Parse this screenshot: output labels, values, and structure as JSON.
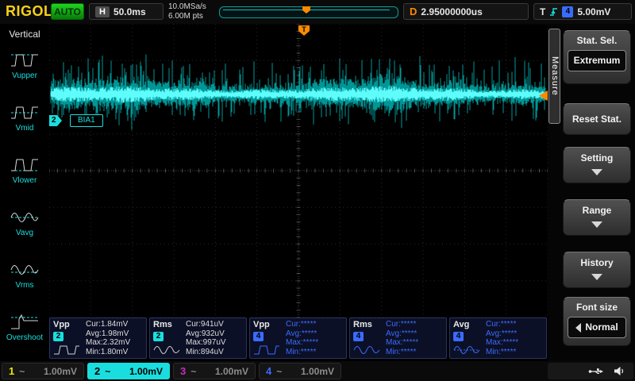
{
  "brand": "RIGOL",
  "top_bar": {
    "status": "AUTO",
    "h_label": "H",
    "h_value": "50.0ms",
    "sample_rate": "10.0MSa/s",
    "mem_depth": "6.00M pts",
    "d_label": "D",
    "d_value": "2.95000000us",
    "t_label": "T",
    "t_channel": "4",
    "t_value": "5.00mV"
  },
  "sidebar": {
    "title": "Vertical",
    "items": [
      {
        "label": "Vupper"
      },
      {
        "label": "Vmid"
      },
      {
        "label": "Vlower"
      },
      {
        "label": "Vavg"
      },
      {
        "label": "Vrms"
      },
      {
        "label": "Overshoot"
      }
    ]
  },
  "scope": {
    "channel_badge": "2",
    "signal_label": "BIA1",
    "trigger_marker_label": "T"
  },
  "waveform": {
    "channel": "2",
    "color_core": "#5ffcfc",
    "color_halo": "#00b0b0",
    "center_frac": 0.24
  },
  "menu": {
    "tab": "Measure",
    "items": {
      "stat_sel_label": "Stat. Sel.",
      "stat_sel_value": "Extremum",
      "reset_label": "Reset Stat.",
      "setting_label": "Setting",
      "range_label": "Range",
      "history_label": "History",
      "font_size_label": "Font size",
      "font_size_value": "Normal"
    }
  },
  "measurements": [
    {
      "name": "Vpp",
      "channel": "2",
      "channel_color": "#1adede",
      "value_color": "#dcdcdc",
      "lines": [
        "Cur:1.84mV",
        "Avg:1.98mV",
        "Max:2.32mV",
        "Min:1.80mV"
      ]
    },
    {
      "name": "Rms",
      "channel": "2",
      "channel_color": "#1adede",
      "value_color": "#dcdcdc",
      "lines": [
        "Cur:941uV",
        "Avg:932uV",
        "Max:997uV",
        "Min:894uV"
      ]
    },
    {
      "name": "Vpp",
      "channel": "4",
      "channel_color": "#3a6bff",
      "value_color": "#3a6bff",
      "lines": [
        "Cur:*****",
        "Avg:*****",
        "Max:*****",
        "Min:*****"
      ]
    },
    {
      "name": "Rms",
      "channel": "4",
      "channel_color": "#3a6bff",
      "value_color": "#3a6bff",
      "lines": [
        "Cur:*****",
        "Avg:*****",
        "Max:*****",
        "Min:*****"
      ]
    },
    {
      "name": "Avg",
      "channel": "4",
      "channel_color": "#3a6bff",
      "value_color": "#3a6bff",
      "lines": [
        "Cur:*****",
        "Avg:*****",
        "Max:*****",
        "Min:*****"
      ]
    }
  ],
  "channels": [
    {
      "num": "1",
      "coupling": "~",
      "scale": "1.00mV",
      "color": "#e8e800",
      "active": false
    },
    {
      "num": "2",
      "coupling": "~",
      "scale": "1.00mV",
      "color": "#1adede",
      "active": true
    },
    {
      "num": "3",
      "coupling": "~",
      "scale": "1.00mV",
      "color": "#c030c0",
      "active": false
    },
    {
      "num": "4",
      "coupling": "~",
      "scale": "1.00mV",
      "color": "#3a6bff",
      "active": false
    }
  ],
  "colors": {
    "accent_cyan": "#1adede",
    "accent_orange": "#ff8a00",
    "auto_green": "#1fd41f",
    "brand_yellow": "#f7d117",
    "ch4_blue": "#3a6bff"
  }
}
